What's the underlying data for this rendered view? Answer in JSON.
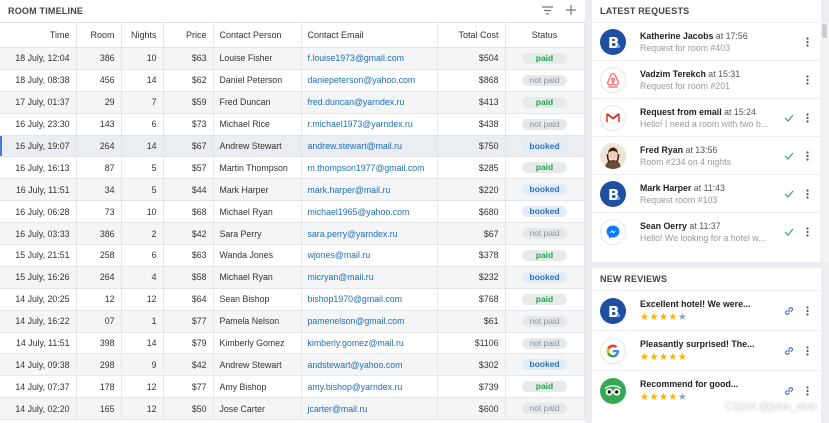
{
  "timeline": {
    "title": "ROOM TIMELINE",
    "columns": [
      "Time",
      "Room",
      "Nights",
      "Price",
      "Contact Person",
      "Contact Email",
      "Total Cost",
      "Status"
    ],
    "rows": [
      {
        "time": "18 July, 12:04",
        "room": "386",
        "nights": "10",
        "price": "$63",
        "person": "Louise Fisher",
        "email": "f.louise1973@gmail.com",
        "total": "$504",
        "status": "paid"
      },
      {
        "time": "18 July, 08:38",
        "room": "456",
        "nights": "14",
        "price": "$62",
        "person": "Daniel Peterson",
        "email": "daniepeterson@yahoo.com",
        "total": "$868",
        "status": "not paid"
      },
      {
        "time": "17 July, 01:37",
        "room": "29",
        "nights": "7",
        "price": "$59",
        "person": "Fred Duncan",
        "email": "fred.duncan@yarndex.ru",
        "total": "$413",
        "status": "paid"
      },
      {
        "time": "16 July, 23:30",
        "room": "143",
        "nights": "6",
        "price": "$73",
        "person": "Michael Rice",
        "email": "r.michael1973@yarndex.ru",
        "total": "$438",
        "status": "not paid"
      },
      {
        "time": "16 July, 19:07",
        "room": "264",
        "nights": "14",
        "price": "$67",
        "person": "Andrew Stewart",
        "email": "andrew.stewart@mail.ru",
        "total": "$750",
        "status": "booked"
      },
      {
        "time": "16 July, 16:13",
        "room": "87",
        "nights": "5",
        "price": "$57",
        "person": "Martin Thompson",
        "email": "m.thompson1977@gmail.com",
        "total": "$285",
        "status": "paid"
      },
      {
        "time": "16 July, 11:51",
        "room": "34",
        "nights": "5",
        "price": "$44",
        "person": "Mark Harper",
        "email": "mark.harper@mail.ru",
        "total": "$220",
        "status": "booked"
      },
      {
        "time": "16 July, 06:28",
        "room": "73",
        "nights": "10",
        "price": "$68",
        "person": "Michael Ryan",
        "email": "michael1965@yahoo.com",
        "total": "$680",
        "status": "booked"
      },
      {
        "time": "16 July, 03:33",
        "room": "386",
        "nights": "2",
        "price": "$42",
        "person": "Sara Perry",
        "email": "sara.perry@yarndex.ru",
        "total": "$67",
        "status": "not paid"
      },
      {
        "time": "15 July, 21:51",
        "room": "258",
        "nights": "6",
        "price": "$63",
        "person": "Wanda Jones",
        "email": "wjones@mail.ru",
        "total": "$378",
        "status": "paid"
      },
      {
        "time": "15 July, 16:26",
        "room": "264",
        "nights": "4",
        "price": "$58",
        "person": "Michael Ryan",
        "email": "micryan@mail.ru",
        "total": "$232",
        "status": "booked"
      },
      {
        "time": "14 July, 20:25",
        "room": "12",
        "nights": "12",
        "price": "$64",
        "person": "Sean Bishop",
        "email": "bishop1970@gmail.com",
        "total": "$768",
        "status": "paid"
      },
      {
        "time": "14 July, 16:22",
        "room": "07",
        "nights": "1",
        "price": "$77",
        "person": "Pamela Nelson",
        "email": "pamenelson@gmail.com",
        "total": "$61",
        "status": "not paid"
      },
      {
        "time": "14 July, 11:51",
        "room": "398",
        "nights": "14",
        "price": "$79",
        "person": "Kimberly Gomez",
        "email": "kimberly.gomez@mail.ru",
        "total": "$1106",
        "status": "not paid"
      },
      {
        "time": "14 July, 09:38",
        "room": "298",
        "nights": "9",
        "price": "$42",
        "person": "Andrew Stewart",
        "email": "andstewart@yahoo.com",
        "total": "$302",
        "status": "booked"
      },
      {
        "time": "14 July, 07:37",
        "room": "178",
        "nights": "12",
        "price": "$77",
        "person": "Amy Bishop",
        "email": "amy.bishop@yarndex.ru",
        "total": "$739",
        "status": "paid"
      },
      {
        "time": "14 July, 02:20",
        "room": "165",
        "nights": "12",
        "price": "$50",
        "person": "Jose Carter",
        "email": "jcarter@mail.ru",
        "total": "$600",
        "status": "not paid"
      }
    ],
    "selected_row": 4
  },
  "requests": {
    "title": "LATEST REQUESTS",
    "items": [
      {
        "icon": "booking-icon",
        "name": "Katherine Jacobs",
        "at": "at",
        "time": "17:56",
        "text": "Request for room #403",
        "done": false
      },
      {
        "icon": "airbnb-icon",
        "name": "Vadzim Terekch",
        "at": "at",
        "time": "15:31",
        "text": "Request for room #201",
        "done": false
      },
      {
        "icon": "gmail-icon",
        "name": "Request from email",
        "at": "at",
        "time": "15:24",
        "text": "Hello! I need a room with two b...",
        "done": true
      },
      {
        "icon": "user-photo-icon",
        "name": "Fred Ryan",
        "at": "at",
        "time": "13:56",
        "text": "Room #234 on 4 nights",
        "done": true
      },
      {
        "icon": "booking-icon",
        "name": "Mark Harper",
        "at": "at",
        "time": "11:43",
        "text": "Request room #103",
        "done": true
      },
      {
        "icon": "messenger-icon",
        "name": "Sean Oerry",
        "at": "at",
        "time": "11:37",
        "text": "Hello! We looking for a hotel w...",
        "done": true
      }
    ]
  },
  "reviews": {
    "title": "NEW REVIEWS",
    "items": [
      {
        "icon": "booking-icon",
        "title": "Excellent hotel! We were...",
        "stars": 4
      },
      {
        "icon": "google-icon",
        "title": "Pleasantly surprised! The...",
        "stars": 5
      },
      {
        "icon": "tripadvisor-icon",
        "title": "Recommend for good...",
        "stars": 4
      }
    ]
  },
  "watermark": "CSDN @john_dwh",
  "colors": {
    "paid": "#1fa84a",
    "booked": "#2f73c2",
    "not_paid": "#8c9199",
    "link": "#1d6fb8",
    "accent": "#3d7fe0"
  }
}
